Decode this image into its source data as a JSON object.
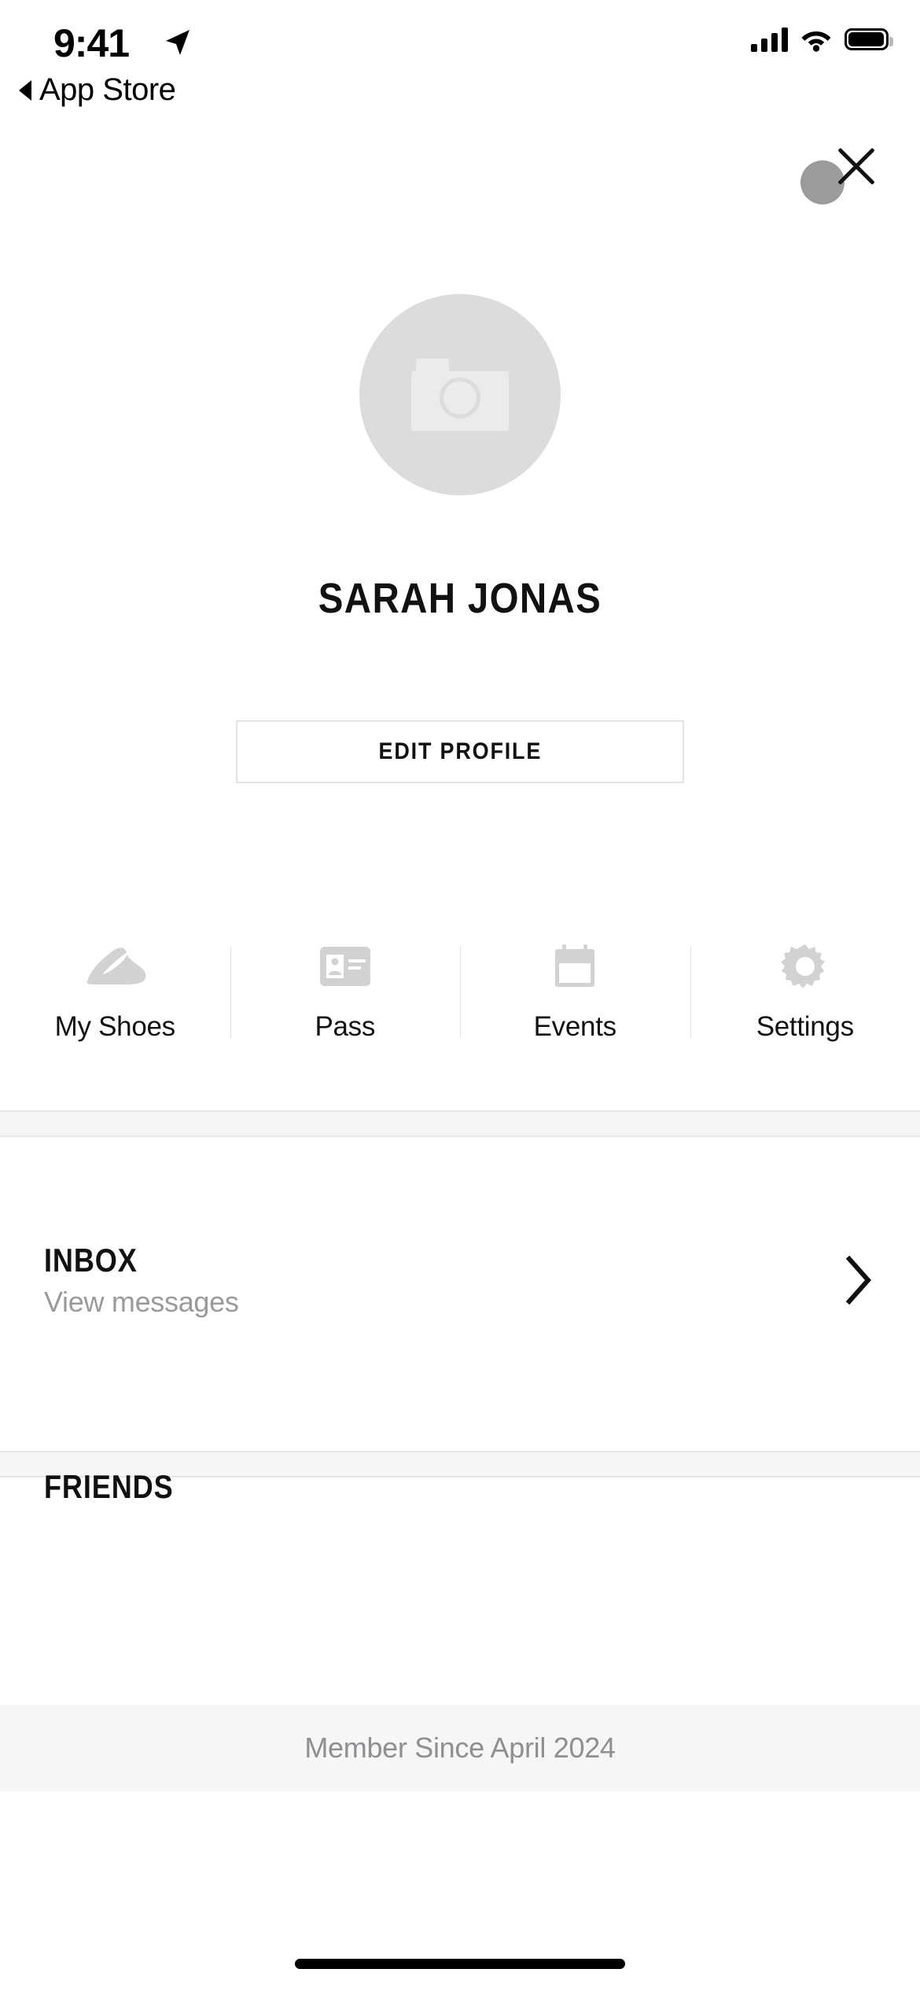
{
  "status_bar": {
    "time": "9:41",
    "location_icon": "location-arrow-icon",
    "signal_icon": "cellular-signal-icon",
    "wifi_icon": "wifi-icon",
    "battery_icon": "battery-full-icon"
  },
  "back_indicator": {
    "icon": "back-triangle-icon",
    "label": "App Store"
  },
  "close_button": {
    "icon": "close-x-icon",
    "circle_color": "#9b9b9b",
    "x_color": "#111111"
  },
  "profile": {
    "avatar": {
      "icon": "camera-placeholder-icon",
      "circle_color": "#dcdcdc",
      "icon_color": "#ebebeb"
    },
    "name": "SARAH JONAS",
    "edit_button_label": "EDIT PROFILE"
  },
  "quick_actions": [
    {
      "label": "My Shoes",
      "icon": "sneaker-icon"
    },
    {
      "label": "Pass",
      "icon": "id-card-icon"
    },
    {
      "label": "Events",
      "icon": "calendar-icon"
    },
    {
      "label": "Settings",
      "icon": "gear-icon"
    }
  ],
  "inbox": {
    "title": "INBOX",
    "subtitle": "View messages",
    "chevron_icon": "chevron-right-icon"
  },
  "friends": {
    "title": "FRIENDS"
  },
  "footer": {
    "membership": "Member Since April 2024"
  },
  "colors": {
    "background": "#ffffff",
    "band": "#f6f6f7",
    "band_border": "#e6e6e8",
    "muted_text": "#9a9a9a",
    "footer_text": "#8e8e93",
    "icon_gray": "#d2d2d4",
    "border": "#e3e3e3"
  }
}
